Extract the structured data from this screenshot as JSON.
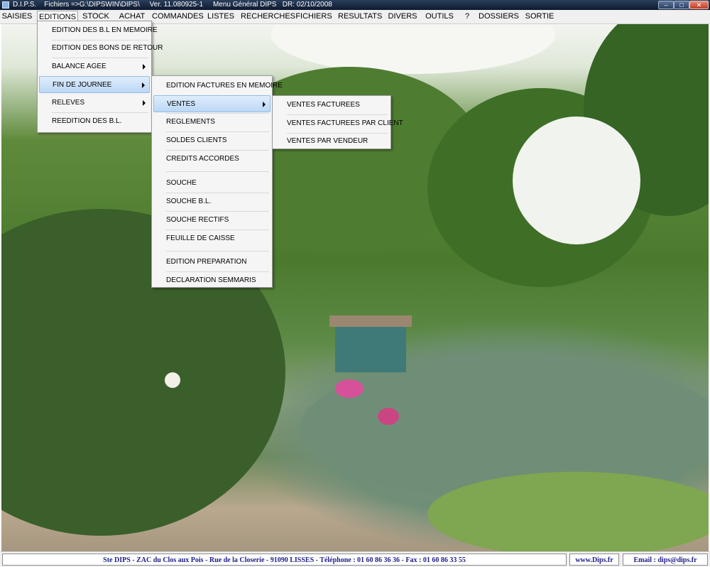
{
  "window": {
    "title": "D.I.P.S.    Fichiers =>G:\\DIPSWIN\\DIPS\\     Ver. 11.080925-1     Menu Général DIPS   DR: 02/10/2008",
    "min_glyph": "–",
    "max_glyph": "□",
    "close_glyph": "✕"
  },
  "menubar": {
    "items": [
      "SAISIES",
      "EDITIONS",
      "STOCK",
      "ACHAT",
      "COMMANDES",
      "LISTES",
      "RECHERCHES",
      "FICHIERS",
      "RESULTATS",
      "DIVERS",
      "OUTILS",
      "?",
      "DOSSIERS",
      "SORTIE"
    ],
    "active": "EDITIONS"
  },
  "editions_menu": {
    "items": [
      "EDITION DES B.L EN MEMOIRE",
      "EDITION DES BONS DE RETOUR",
      "BALANCE AGEE",
      "FIN DE JOURNEE",
      "RELEVES",
      "REEDITION DES B.L."
    ],
    "highlighted": "FIN DE JOURNEE"
  },
  "fin_journee_menu": {
    "items": [
      "EDITION  FACTURES EN MEMOIRE",
      "VENTES",
      "REGLEMENTS",
      "SOLDES CLIENTS",
      "CREDITS ACCORDES",
      "SOUCHE",
      "SOUCHE B.L.",
      "SOUCHE RECTIFS",
      "FEUILLE DE CAISSE",
      "EDITION  PREPARATION",
      "DECLARATION SEMMARIS"
    ],
    "highlighted": "VENTES"
  },
  "ventes_menu": {
    "items": [
      "VENTES FACTUREES",
      "VENTES FACTUREES PAR CLIENT",
      "VENTES PAR VENDEUR"
    ]
  },
  "statusbar": {
    "company": "Ste DIPS - ZAC du Clos aux Pois - Rue de la Closerie - 91090 LISSES  -  Téléphone : 01 60 86 36 36 - Fax : 01 60 86 33 55",
    "website": "www.Dips.fr",
    "email": "Email : dips@dips.fr"
  },
  "colors": {
    "menu_highlight": "#bcd8f5",
    "status_text": "#20208c"
  }
}
